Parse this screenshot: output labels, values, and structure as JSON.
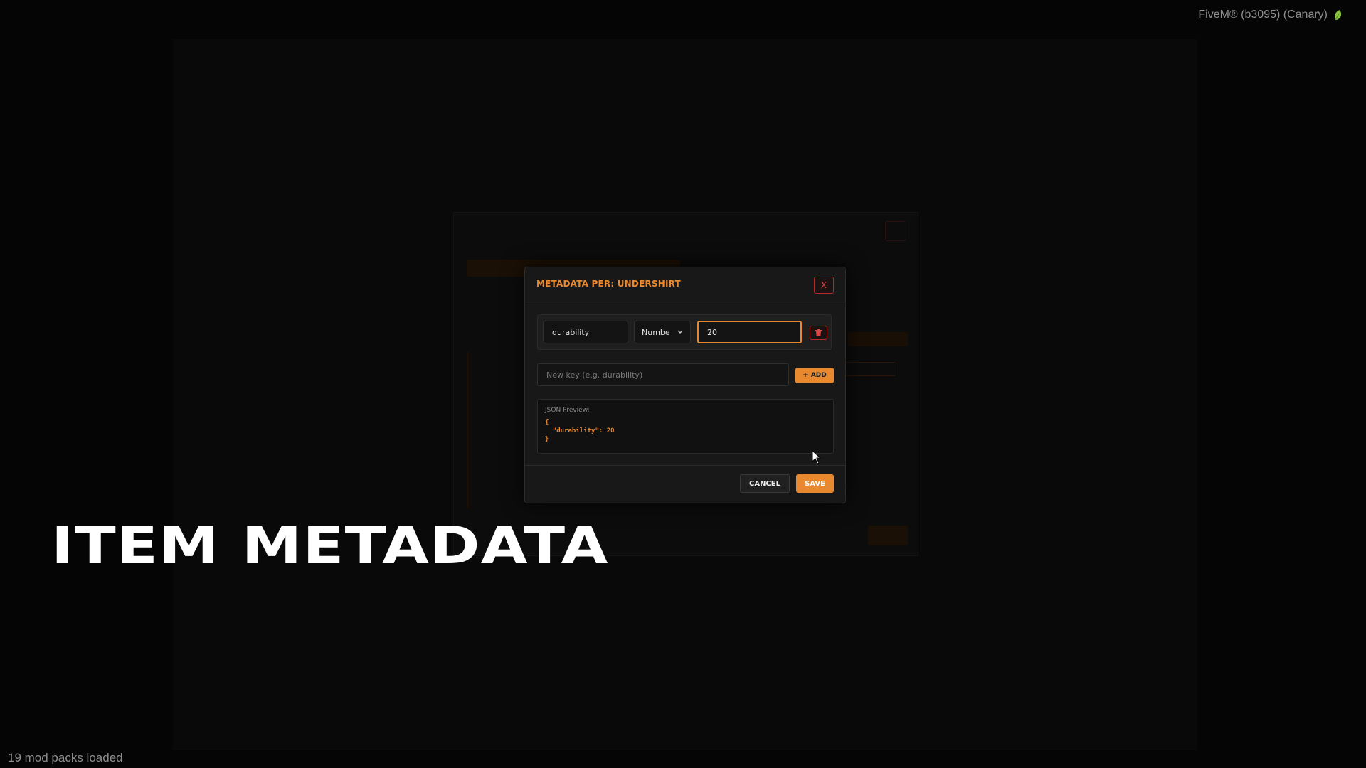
{
  "window": {
    "title": "FiveM® (b3095) (Canary)",
    "icon": "leaf-icon"
  },
  "status_bar": {
    "text": "19 mod packs loaded"
  },
  "overlay": {
    "title": "ITEM METADATA"
  },
  "modal": {
    "title": "METADATA PER: UNDERSHIRT",
    "close_label": "X",
    "entry": {
      "key": "durability",
      "type": "Numbe",
      "value": "20",
      "delete_icon": "trash-icon"
    },
    "new_key_placeholder": "New key (e.g. durability)",
    "add_label": "ADD",
    "json_preview": {
      "label": "JSON Preview:",
      "lines": [
        "{",
        "  \"durability\": 20",
        "}"
      ]
    },
    "cancel_label": "CANCEL",
    "save_label": "SAVE"
  },
  "colors": {
    "accent": "#e8892f",
    "danger": "#e04545",
    "background": "#050505",
    "modal": "#181818"
  }
}
